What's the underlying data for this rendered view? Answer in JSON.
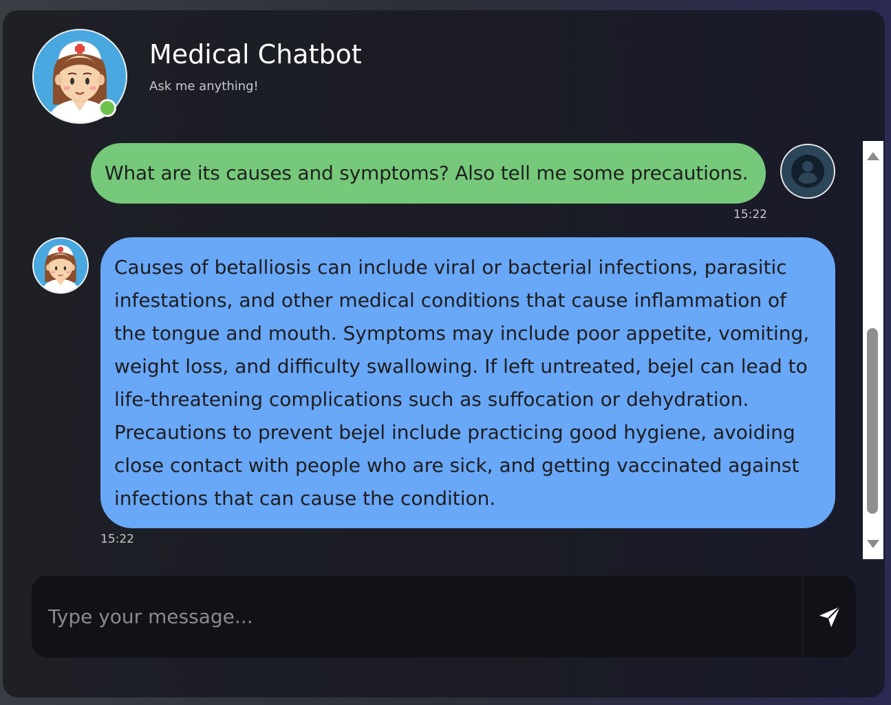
{
  "header": {
    "title": "Medical Chatbot",
    "subtitle": "Ask me anything!",
    "avatar_icon": "nurse-avatar-icon",
    "status": "online",
    "status_color": "#6cc24a"
  },
  "messages": [
    {
      "sender": "user",
      "text": "What are its causes and symptoms? Also tell me some precautions.",
      "time": "15:22",
      "bubble_color": "#76c97a",
      "avatar_icon": "user-icon"
    },
    {
      "sender": "bot",
      "text": "Causes of betalliosis can include viral or bacterial infections, parasitic infestations, and other medical conditions that cause inflammation of the tongue and mouth. Symptoms may include poor appetite, vomiting, weight loss, and difficulty swallowing. If left untreated, bejel can lead to life-threatening complications such as suffocation or dehydration. Precautions to prevent bejel include practicing good hygiene, avoiding close contact with people who are sick, and getting vaccinated against infections that can cause the condition.",
      "time": "15:22",
      "bubble_color": "#69a7f7",
      "avatar_icon": "nurse-avatar-icon"
    }
  ],
  "input": {
    "placeholder": "Type your message...",
    "value": ""
  },
  "send_button": {
    "icon": "send-icon"
  }
}
